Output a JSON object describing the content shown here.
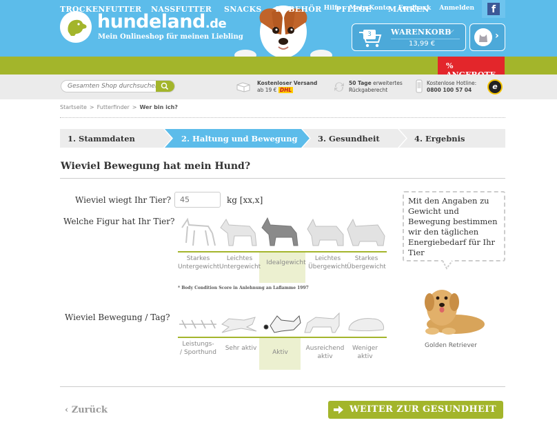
{
  "header": {
    "logo_text": "hundeland",
    "logo_suffix": ".de",
    "tagline": "Mein Onlineshop für meinen Liebling",
    "top_links": [
      "Hilfe",
      "Mein Konto",
      "Feedback",
      "Anmelden"
    ],
    "facebook_glyph": "f",
    "cart": {
      "count": "3",
      "title": "WARENKORB",
      "total": "13,99 €"
    }
  },
  "nav": {
    "items": [
      "TROCKENFUTTER",
      "NASSFUTTER",
      "SNACKS",
      "ZUBEHÖR",
      "PFLEGE",
      "MARKEN"
    ],
    "offers": "% ANGEBOTE",
    "bg_color": "#a3b52b",
    "offers_color": "#e3262b"
  },
  "service": {
    "search_placeholder": "Gesamten Shop durchsuchen",
    "shipping_title": "Kostenloser Versand",
    "shipping_sub": "ab 19 €",
    "carrier": "DHL",
    "returns_title": "50 Tage",
    "returns_rest": " erweitertes",
    "returns_sub": "Rückgaberecht",
    "hotline_title": "Kostenlose Hotline:",
    "hotline_number": "0800 100 57 04",
    "trust_glyph": "e"
  },
  "breadcrumb": {
    "items": [
      "Startseite",
      ">",
      "Futterfinder",
      ">",
      "Wer bin ich?"
    ]
  },
  "steps": [
    "1. Stammdaten",
    "2. Haltung und Bewegung",
    "3. Gesundheit",
    "4. Ergebnis"
  ],
  "active_step": 2,
  "question_title": "Wieviel Bewegung hat mein Hund?",
  "weight": {
    "label": "Wieviel wiegt Ihr Tier?",
    "placeholder": "45",
    "unit": "kg [xx,x]"
  },
  "figure": {
    "label": "Welche Figur hat Ihr Tier?",
    "options": [
      {
        "line1": "Starkes",
        "line2": "Untergewicht"
      },
      {
        "line1": "Leichtes",
        "line2": "Untergewicht"
      },
      {
        "line1": "Idealgewicht",
        "line2": ""
      },
      {
        "line1": "Leichtes",
        "line2": "Übergewicht"
      },
      {
        "line1": "Starkes",
        "line2": "Übergewicht"
      }
    ],
    "selected_index": 2,
    "note": "* Body Condition Score in Anlehnung an Laflamme 1997"
  },
  "activity": {
    "label": "Wieviel Bewegung / Tag?",
    "options": [
      {
        "line1": "Leistungs-",
        "line2": "/ Sporthund"
      },
      {
        "line1": "Sehr aktiv",
        "line2": ""
      },
      {
        "line1": "Aktiv",
        "line2": ""
      },
      {
        "line1": "Ausreichend",
        "line2": "aktiv"
      },
      {
        "line1": "Weniger",
        "line2": "aktiv"
      }
    ],
    "selected_index": 2
  },
  "info_bubble": "Mit den Angaben zu Gewicht und Bewegung bestimmen wir den täglichen Energiebedarf für Ihr Tier",
  "dog_breed": "Golden Retriever",
  "footer": {
    "back": "Zurück",
    "back_arrow": "‹",
    "next": "WEITER ZUR GESUNDHEIT"
  }
}
